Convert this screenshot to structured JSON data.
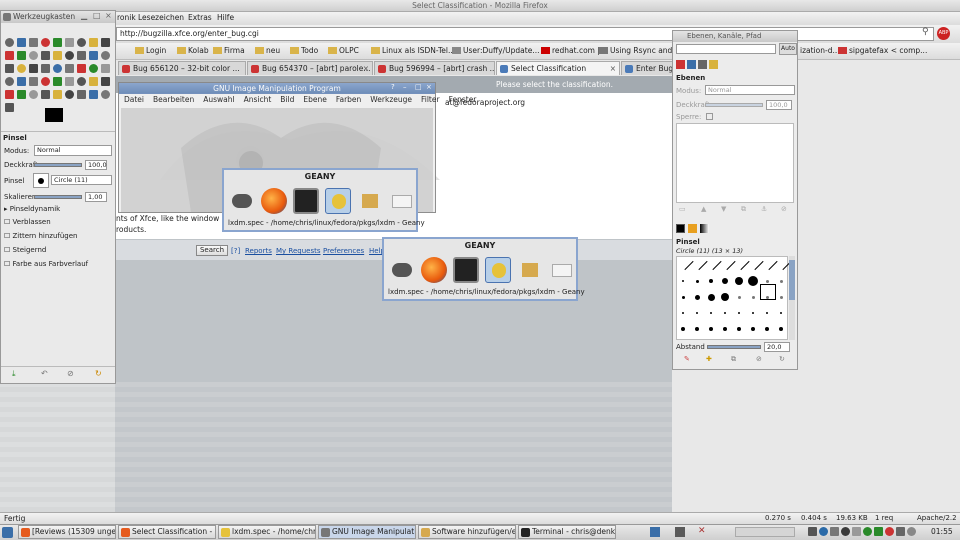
{
  "firefox": {
    "title": "Select Classification - Mozilla Firefox",
    "menu": [
      "ronik",
      "Lesezeichen",
      "Extras",
      "Hilfe"
    ],
    "url": "http://bugzilla.xfce.org/enter_bug.cgi",
    "bookmarks": [
      "Login",
      "Kolab",
      "Firma",
      "neu",
      "Todo",
      "OLPC",
      "Linux als ISDN-Tel...",
      "User:Duffy/Update...",
      "redhat.com |",
      "Using Rsync and S...",
      "ization-d...",
      "sipgatefax < comp..."
    ],
    "tabs": [
      "Bug 656120 – 32-bit color ...",
      "Bug 654370 – [abrt] parole...",
      "Bug 596994 – [abrt] crash ...",
      "Select Classification",
      "Enter Bug:"
    ],
    "header_msg": "Please select the classification.",
    "email_fragment": "at@fedoraproject.org",
    "xfce_fragment": "nts of Xfce, like the window man",
    "products_fragment": "roducts.",
    "search_button": "Search",
    "links": [
      "[?]",
      "Reports",
      "My Requests",
      "Preferences",
      "Help"
    ],
    "status_left": "Fertig",
    "status_items": [
      "0.270 s",
      "0.404 s",
      "19.63 KB",
      "1 req",
      "Apache/2.2"
    ],
    "auto_label": "Auto"
  },
  "toolbox": {
    "title": "Werkzeugkasten",
    "brush_section": "Pinsel",
    "modus_label": "Modus:",
    "modus_value": "Normal",
    "deckkraft_label": "Deckkraft",
    "deckkraft_value": "100,0",
    "pinsel_label": "Pinsel",
    "pinsel_value": "Circle (11)",
    "skalieren_label": "Skalieren",
    "skalieren_value": "1,00",
    "options": [
      "Pinseldynamik",
      "Verblassen",
      "Zittern hinzufügen",
      "Steigernd",
      "Farbe aus Farbverlauf"
    ]
  },
  "gimp_main": {
    "title": "GNU Image Manipulation Program",
    "menu": [
      "Datei",
      "Bearbeiten",
      "Auswahl",
      "Ansicht",
      "Bild",
      "Ebene",
      "Farben",
      "Werkzeuge",
      "Filter",
      "Fenster"
    ]
  },
  "switcher1": {
    "title": "GEANY",
    "caption": "lxdm.spec - /home/chris/linux/fedora/pkgs/lxdm - Geany"
  },
  "switcher2": {
    "title": "GEANY",
    "caption": "lxdm.spec - /home/chris/linux/fedora/pkgs/lxdm - Geany"
  },
  "layers": {
    "title": "Ebenen, Kanäle, Pfad",
    "section": "Ebenen",
    "modus_label": "Modus:",
    "modus_value": "Normal",
    "deckkraft_label": "Deckkraft",
    "deckkraft_value": "100,0",
    "sperre_label": "Sperre:",
    "brushes_section": "Pinsel",
    "brush_name": "Circle (11) (13 × 13)",
    "abstand_label": "Abstand",
    "abstand_value": "20,0"
  },
  "taskbar": {
    "buttons": [
      "[Reviews (15309 ungel...",
      "Select Classification - ...",
      "lxdm.spec - /home/chri...",
      "GNU Image Manipulatio...",
      "Software hinzufügen/e...",
      "Terminal - chris@denke..."
    ],
    "clock": "01:55"
  }
}
